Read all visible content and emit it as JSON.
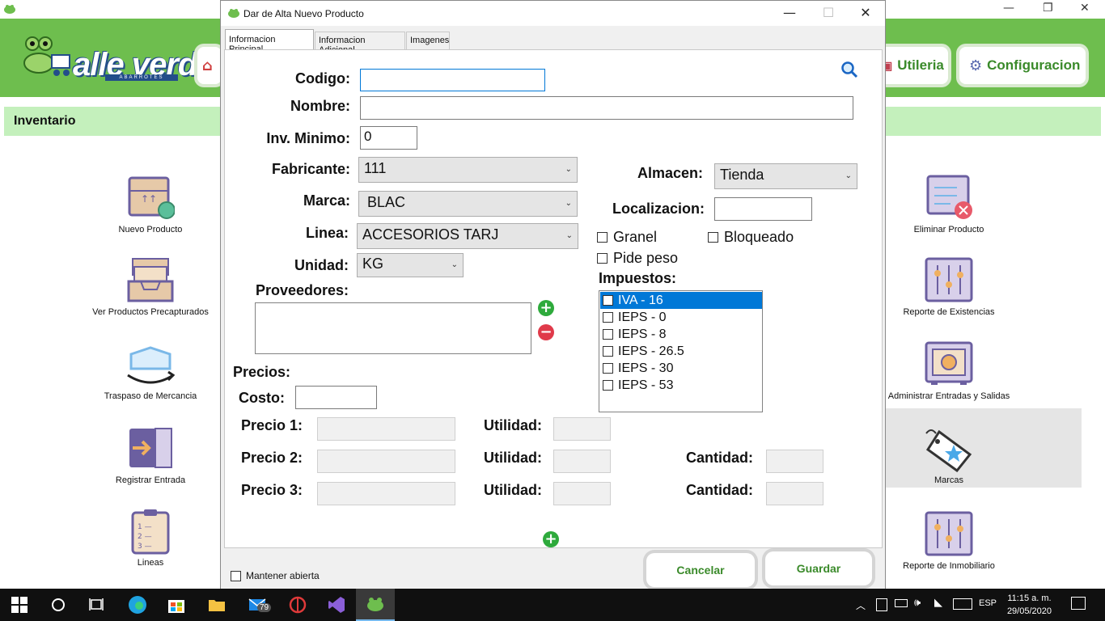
{
  "app": {
    "header_buttons": [
      {
        "label": "Utileria",
        "icon": "toolbox-icon"
      },
      {
        "label": "Configuracion",
        "icon": "gear-icon"
      }
    ],
    "logo": {
      "text": "alle verde",
      "sub": "ABARROTES"
    },
    "section_title": "Inventario",
    "left_tiles": [
      {
        "label": "Nuevo Producto",
        "icon": "box-icon"
      },
      {
        "label": "Ver Productos Precapturados",
        "icon": "inbox-tray-icon"
      },
      {
        "label": "Traspaso de Mercancia",
        "icon": "open-box-icon"
      },
      {
        "label": "Registrar Entrada",
        "icon": "entry-door-icon"
      },
      {
        "label": "Lineas",
        "icon": "clipboard-list-icon"
      }
    ],
    "right_tiles": [
      {
        "label": "Eliminar Producto",
        "icon": "delete-list-icon"
      },
      {
        "label": "Reporte de Existencias",
        "icon": "sliders-icon"
      },
      {
        "label": "Administrar Entradas y Salidas",
        "icon": "safe-icon"
      },
      {
        "label": "Marcas",
        "icon": "tag-icon"
      },
      {
        "label": "Reporte de Inmobiliario",
        "icon": "sliders-icon"
      }
    ]
  },
  "dialog": {
    "title": "Dar de Alta Nuevo Producto",
    "tabs": [
      "Informacion Principal",
      "Informacion Adicional",
      "Imagenes"
    ],
    "fields": {
      "codigo": {
        "label": "Codigo:",
        "value": ""
      },
      "nombre": {
        "label": "Nombre:",
        "value": ""
      },
      "inv_minimo": {
        "label": "Inv. Minimo:",
        "value": "0"
      },
      "fabricante": {
        "label": "Fabricante:",
        "value": "111"
      },
      "marca": {
        "label": "Marca:",
        "value": "BLAC"
      },
      "linea": {
        "label": "Linea:",
        "value": "ACCESORIOS TARJ"
      },
      "unidad": {
        "label": "Unidad:",
        "value": "KG"
      },
      "almacen": {
        "label": "Almacen:",
        "value": "Tienda"
      },
      "localizacion": {
        "label": "Localizacion:",
        "value": ""
      }
    },
    "checkboxes": {
      "granel": "Granel",
      "bloqueado": "Bloqueado",
      "pide_peso": "Pide peso"
    },
    "proveedores_label": "Proveedores:",
    "impuestos_label": "Impuestos:",
    "impuestos": [
      "IVA - 16",
      "IEPS - 0",
      "IEPS - 8",
      "IEPS - 26.5",
      "IEPS - 30",
      "IEPS - 53"
    ],
    "precios_label": "Precios:",
    "costo_label": "Costo:",
    "precio_rows": [
      {
        "precio": "Precio 1:",
        "utilidad": "Utilidad:",
        "cantidad": ""
      },
      {
        "precio": "Precio 2:",
        "utilidad": "Utilidad:",
        "cantidad": "Cantidad:"
      },
      {
        "precio": "Precio 3:",
        "utilidad": "Utilidad:",
        "cantidad": "Cantidad:"
      }
    ],
    "mantener_abierta": "Mantener abierta",
    "cancelar": "Cancelar",
    "guardar": "Guardar"
  },
  "taskbar": {
    "mail_badge": "79",
    "lang": "ESP",
    "time": "11:15 a. m.",
    "date": "29/05/2020"
  },
  "colors": {
    "header_green": "#6ebe4e",
    "section_bar": "#c4f0bc",
    "button_text_green": "#3a8a2a",
    "selection_blue": "#0078d7"
  }
}
